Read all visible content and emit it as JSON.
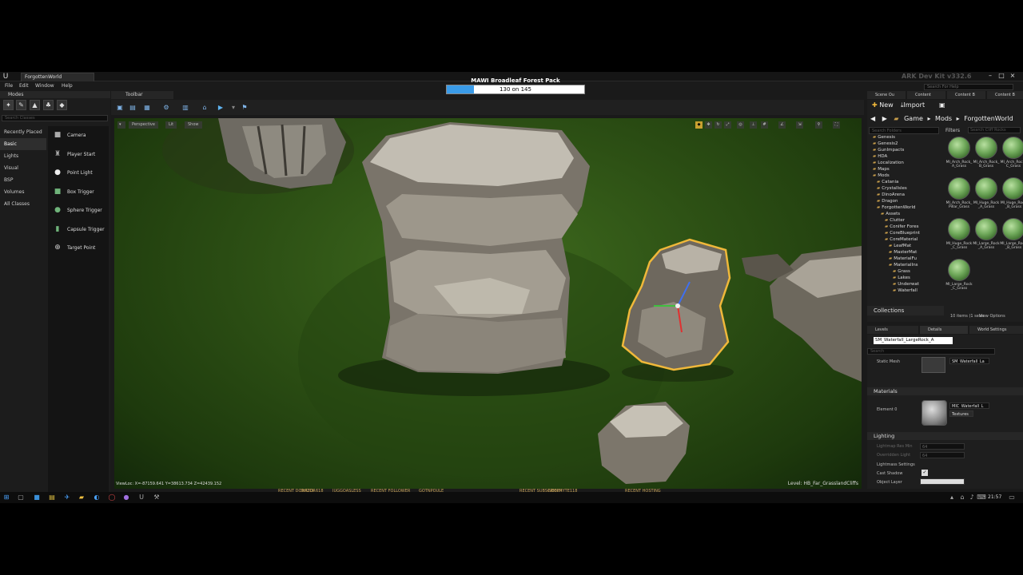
{
  "window": {
    "project_tab": "ForgottenWorld",
    "center_title": "MAWI Broadleaf Forest Pack",
    "progress_text": "130 on 145",
    "progress_fraction": 0.2,
    "devkit_label": "ARK Dev Kit v332.6",
    "help_search_placeholder": "Search For Help"
  },
  "menu": [
    "File",
    "Edit",
    "Window",
    "Help"
  ],
  "modes": {
    "tab_label": "Modes",
    "search_placeholder": "Search Classes",
    "categories": [
      "Recently Placed",
      "Basic",
      "Lights",
      "Visual",
      "BSP",
      "Volumes",
      "All Classes"
    ],
    "items": [
      {
        "label": "Camera",
        "icon": "camera-icon"
      },
      {
        "label": "Player Start",
        "icon": "player-start-icon"
      },
      {
        "label": "Point Light",
        "icon": "point-light-icon"
      },
      {
        "label": "Box Trigger",
        "icon": "box-trigger-icon"
      },
      {
        "label": "Sphere Trigger",
        "icon": "sphere-trigger-icon"
      },
      {
        "label": "Capsule Trigger",
        "icon": "capsule-trigger-icon"
      },
      {
        "label": "Target Point",
        "icon": "target-point-icon"
      }
    ]
  },
  "toolbar": {
    "tab_label": "Toolbar"
  },
  "viewport": {
    "perspective_label": "Perspective",
    "lit_label": "Lit",
    "show_label": "Show",
    "view_loc": "ViewLoc: X=-87159.641 Y=38613.734 Z=42439.152",
    "level": "Level: HB_Far_GrasslandCliffs"
  },
  "content_browser": {
    "tabs": [
      "Scene Ou",
      "Content",
      "Content B"
    ],
    "new_label": "New",
    "import_label": "Import",
    "path": [
      "Game",
      "Mods",
      "ForgottenWorld"
    ],
    "folder_search_placeholder": "Search Folders",
    "filters_label": "Filters",
    "asset_search_placeholder": "Search Cliff Rocks",
    "folders": [
      {
        "name": "Genesis",
        "indent": 1
      },
      {
        "name": "Genesis2",
        "indent": 1
      },
      {
        "name": "GunImpacts",
        "indent": 1
      },
      {
        "name": "HDA",
        "indent": 1
      },
      {
        "name": "Localization",
        "indent": 1
      },
      {
        "name": "Maps",
        "indent": 1
      },
      {
        "name": "Mods",
        "indent": 1
      },
      {
        "name": "Catania",
        "indent": 2
      },
      {
        "name": "CrystalIsles",
        "indent": 2
      },
      {
        "name": "DinoArena",
        "indent": 2
      },
      {
        "name": "Dragon",
        "indent": 2
      },
      {
        "name": "ForgottenWorld",
        "indent": 2
      },
      {
        "name": "Assets",
        "indent": 3
      },
      {
        "name": "Clutter",
        "indent": 4
      },
      {
        "name": "Conifer Fores",
        "indent": 4
      },
      {
        "name": "CoreBlueprint",
        "indent": 4
      },
      {
        "name": "CoreMaterial",
        "indent": 4
      },
      {
        "name": "LeafMat",
        "indent": 5
      },
      {
        "name": "MasterMat",
        "indent": 5
      },
      {
        "name": "MaterialFu",
        "indent": 5
      },
      {
        "name": "MaterialIns",
        "indent": 5
      },
      {
        "name": "Grass",
        "indent": 6
      },
      {
        "name": "Lakes",
        "indent": 6
      },
      {
        "name": "Underwat",
        "indent": 6
      },
      {
        "name": "Waterfall",
        "indent": 6
      }
    ],
    "assets": [
      "MI_Arch_Rock_A_Grass",
      "MI_Arch_Rock_B_Grass",
      "MI_Arch_Rock_C_Grass",
      "MI_Arch_Rock_Pillar_Grass",
      "MI_Huge_Rock_A_Grass",
      "MI_Huge_Rock_B_Grass",
      "MI_Huge_Rock_C_Grass",
      "MI_Large_Rock_A_Grass",
      "MI_Large_Rock_B_Grass",
      "MI_Large_Rock_C_Grass"
    ],
    "collections_label": "Collections",
    "items_count": "10 items (1 selec",
    "view_options": "View Options"
  },
  "details": {
    "tabs": [
      "Levels",
      "Details",
      "World Settings"
    ],
    "name": "SM_Waterfall_LargeRock_A",
    "search_placeholder": "Search",
    "static_mesh_label": "Static Mesh",
    "static_mesh_value": "SM_Waterfall_La",
    "materials_header": "Materials",
    "element_label": "Element 0",
    "material_value": "MIC_Waterfall_L",
    "textures_label": "Textures",
    "lighting_header": "Lighting",
    "lightmap_res_label": "Lightmap Res Min",
    "lightmap_res_value": "64",
    "overridden_label": "Overridden Light",
    "overridden_value": "64",
    "lightmass_label": "Lightmass Settings",
    "cast_shadow_label": "Cast Shadow",
    "object_layer_label": "Object Layer"
  },
  "hud": [
    "RECENT DONATOR",
    "SHIZO: 618",
    "JUGGOASLESS",
    "RECENT FOLLOWER",
    "GOTNPOULE",
    "RECENT SUBSCRIBER",
    "NEOPHYTE118",
    "RECENT HOSTING"
  ],
  "taskbar": {
    "time": "21:57"
  },
  "colors": {
    "accent": "#3a9be8",
    "selection": "#f0b83a",
    "folder": "#c79d4a"
  }
}
